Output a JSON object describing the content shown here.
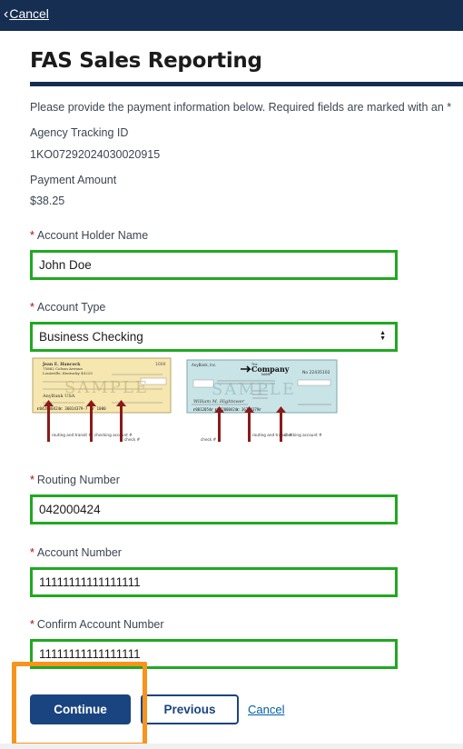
{
  "topbar": {
    "cancel_label": "Cancel"
  },
  "page_title": "FAS Sales Reporting",
  "intro_text": "Please provide the payment information below. Required fields are marked with an *",
  "agency_tracking": {
    "label": "Agency Tracking ID",
    "value": "1KO07292024030020915"
  },
  "payment_amount": {
    "label": "Payment Amount",
    "value": "$38.25"
  },
  "required_marker": "*",
  "fields": {
    "account_holder": {
      "label": "Account Holder Name",
      "value": "John Doe"
    },
    "account_type": {
      "label": "Account Type",
      "value": "Business Checking"
    },
    "routing_number": {
      "label": "Routing Number",
      "value": "042000424"
    },
    "account_number": {
      "label": "Account Number",
      "value": "11111111111111111"
    },
    "confirm_account_number": {
      "label": "Confirm Account Number",
      "value": "11111111111111111"
    }
  },
  "check_images": {
    "personal": {
      "name_line1": "Jean E. Hancock",
      "name_line2": "75862 Colson Avenue",
      "name_line3": "Louisville, Kentucky 40225",
      "check_no": "1000",
      "bank": "AnyBank USA",
      "micr": "⑆042000424⑆  36014379-7 C⑈  1000",
      "watermark": "SAMPLE",
      "arrow_labels": [
        "routing and transit #",
        "checking account #",
        "check #"
      ]
    },
    "business": {
      "company_line1": "AnyBank, Inc.",
      "company_name": "Company",
      "company_prefix": "The",
      "company_suffix": "NAME",
      "check_no": "No 22435102",
      "signature": "William M. Hightower",
      "watermark": "SAMPLE",
      "arrow_labels": [
        "check #",
        "routing and transit #",
        "checking account #"
      ]
    }
  },
  "buttons": {
    "continue": "Continue",
    "previous": "Previous",
    "cancel": "Cancel"
  },
  "colors": {
    "navy": "#162e51",
    "primary": "#1a4480",
    "field_highlight": "#21a821",
    "action_highlight": "#f7941d",
    "required": "#b50909"
  }
}
